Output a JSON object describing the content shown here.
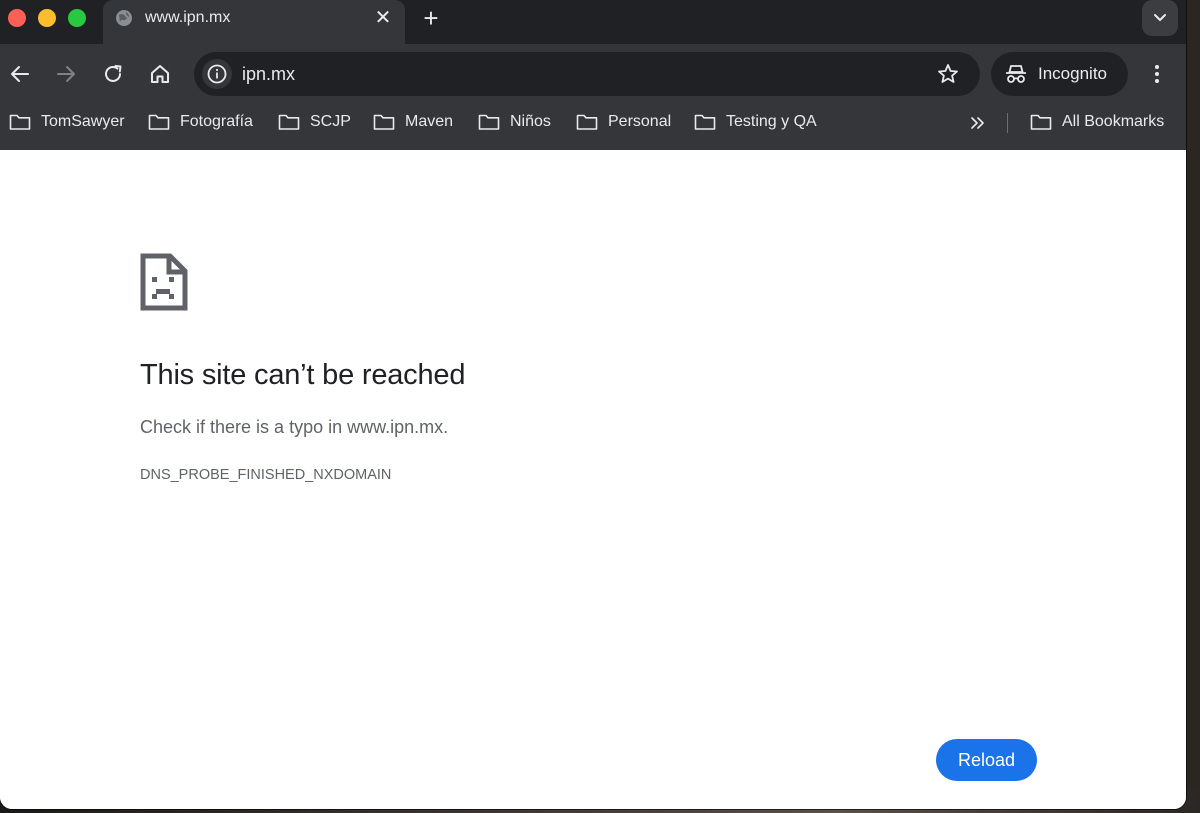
{
  "tab": {
    "title": "www.ipn.mx",
    "close_glyph": "✕",
    "new_tab_glyph": "+"
  },
  "omnibox": {
    "url": "ipn.mx"
  },
  "profile": {
    "label": "Incognito"
  },
  "bookmarks": [
    {
      "label": "TomSawyer"
    },
    {
      "label": "Fotografía"
    },
    {
      "label": "SCJP"
    },
    {
      "label": "Maven"
    },
    {
      "label": "Niños"
    },
    {
      "label": "Personal"
    },
    {
      "label": "Testing y QA"
    }
  ],
  "all_bookmarks": {
    "label": "All Bookmarks"
  },
  "error": {
    "title": "This site can’t be reached",
    "description": "Check if there is a typo in www.ipn.mx.",
    "code": "DNS_PROBE_FINISHED_NXDOMAIN",
    "reload_label": "Reload"
  },
  "colors": {
    "accent": "#1a73e8",
    "chrome_dark": "#202124",
    "toolbar": "#35363a"
  },
  "icons": [
    "globe-icon",
    "close-icon",
    "plus-icon",
    "chevron-down-icon",
    "back-arrow-icon",
    "forward-arrow-icon",
    "reload-icon",
    "home-icon",
    "info-icon",
    "star-icon",
    "incognito-icon",
    "more-vert-icon",
    "folder-icon",
    "double-chevron-right-icon",
    "sad-file-icon"
  ]
}
